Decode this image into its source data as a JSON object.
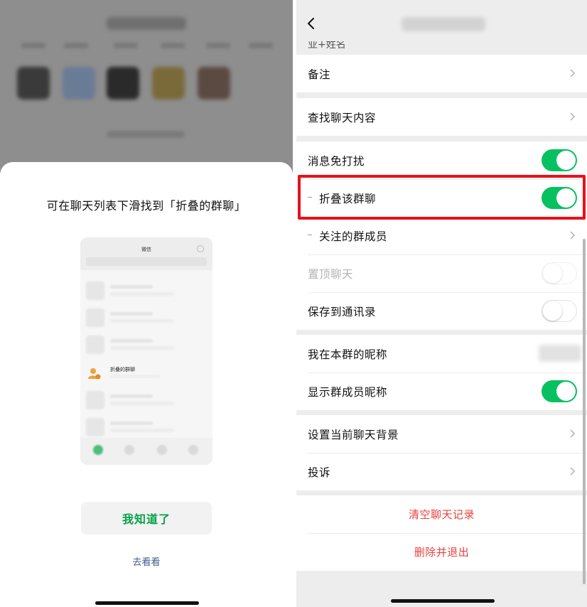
{
  "left_panel": {
    "sheet": {
      "title": "可在聊天列表下滑找到「折叠的群聊」",
      "preview": {
        "header_title": "微信",
        "folded_chat_label": "折叠的群聊"
      },
      "confirm_button": "我知道了",
      "go_see_link": "去看看"
    }
  },
  "right_panel": {
    "nav": {
      "cut_text": "业+姓名"
    },
    "groups": {
      "remark": {
        "label": "备注"
      },
      "search_history": {
        "label": "查找聊天内容"
      },
      "mute": {
        "label": "消息免打扰",
        "on": true
      },
      "fold_group": {
        "label": "折叠该群聊",
        "on": true
      },
      "followed_members": {
        "label": "关注的群成员"
      },
      "pin": {
        "label": "置顶聊天",
        "on": false
      },
      "save_contacts": {
        "label": "保存到通讯录",
        "on": false
      },
      "my_nickname": {
        "label": "我在本群的昵称"
      },
      "show_nicknames": {
        "label": "显示群成员昵称",
        "on": true
      },
      "set_background": {
        "label": "设置当前聊天背景"
      },
      "complain": {
        "label": "投诉"
      },
      "clear_history": {
        "label": "清空聊天记录"
      },
      "delete_exit": {
        "label": "删除并退出"
      }
    }
  },
  "colors": {
    "accent_green": "#07c160",
    "button_green_text": "#07a14a",
    "danger_red": "#e64340",
    "highlight_red": "#e8101c",
    "link_blue": "#3d5d8c"
  }
}
